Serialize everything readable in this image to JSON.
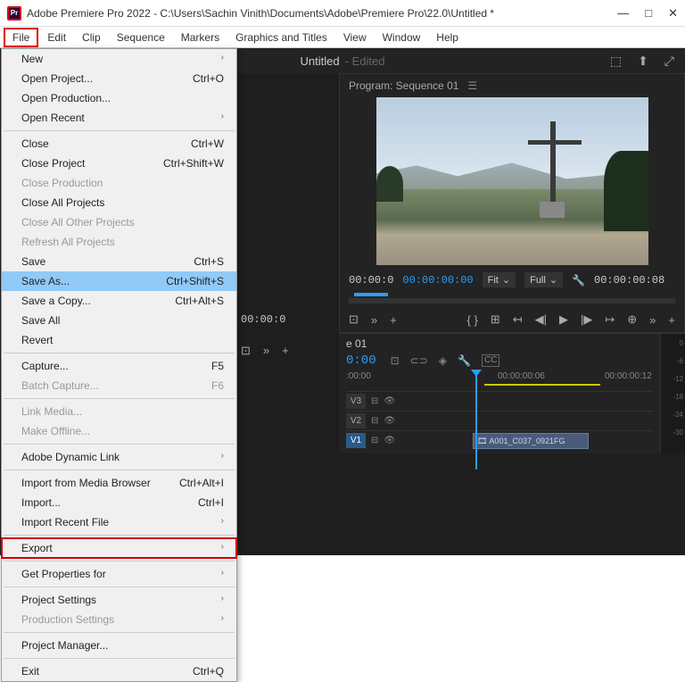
{
  "title": "Adobe Premiere Pro 2022 - C:\\Users\\Sachin Vinith\\Documents\\Adobe\\Premiere Pro\\22.0\\Untitled *",
  "app_icon_text": "Pr",
  "win": {
    "min": "—",
    "max": "□",
    "close": "✕"
  },
  "menubar": [
    "File",
    "Edit",
    "Clip",
    "Sequence",
    "Markers",
    "Graphics and Titles",
    "View",
    "Window",
    "Help"
  ],
  "top_tab": {
    "name": "Untitled",
    "state": "- Edited"
  },
  "icons_tr": [
    "⬚",
    "⬆",
    "⤢"
  ],
  "program": {
    "title": "Program: Sequence 01",
    "tc_left": "00:00:0",
    "tc_cur": "00:00:00:00",
    "fit": "Fit",
    "full": "Full",
    "tc_right": "00:00:00:08",
    "playbtns": [
      "{ }",
      "⊞",
      "↤",
      "◀|",
      "▶",
      "|▶",
      "↦",
      "⊕",
      "»",
      "+"
    ],
    "src_btns": [
      "⊡",
      "»",
      "+"
    ]
  },
  "seq": {
    "tab": "e 01",
    "time": "0:00",
    "ruler": [
      ":00:00",
      "00:00:00:06",
      "00:00:00:12",
      "00:00:00"
    ],
    "tracks": [
      {
        "lbl": "V3",
        "blue": false
      },
      {
        "lbl": "V2",
        "blue": false
      },
      {
        "lbl": "V1",
        "blue": true,
        "clip": "A001_C037_0921FG"
      }
    ],
    "meter": [
      "0",
      "-6",
      "-12",
      "-18",
      "-24",
      "-30"
    ]
  },
  "dropdown": [
    {
      "t": "item",
      "label": "New",
      "sub": true
    },
    {
      "t": "item",
      "label": "Open Project...",
      "sc": "Ctrl+O"
    },
    {
      "t": "item",
      "label": "Open Production..."
    },
    {
      "t": "item",
      "label": "Open Recent",
      "sub": true
    },
    {
      "t": "sep"
    },
    {
      "t": "item",
      "label": "Close",
      "sc": "Ctrl+W"
    },
    {
      "t": "item",
      "label": "Close Project",
      "sc": "Ctrl+Shift+W"
    },
    {
      "t": "item",
      "label": "Close Production",
      "disabled": true
    },
    {
      "t": "item",
      "label": "Close All Projects"
    },
    {
      "t": "item",
      "label": "Close All Other Projects",
      "disabled": true
    },
    {
      "t": "item",
      "label": "Refresh All Projects",
      "disabled": true
    },
    {
      "t": "item",
      "label": "Save",
      "sc": "Ctrl+S"
    },
    {
      "t": "item",
      "label": "Save As...",
      "sc": "Ctrl+Shift+S",
      "hl": true
    },
    {
      "t": "item",
      "label": "Save a Copy...",
      "sc": "Ctrl+Alt+S"
    },
    {
      "t": "item",
      "label": "Save All"
    },
    {
      "t": "item",
      "label": "Revert"
    },
    {
      "t": "sep"
    },
    {
      "t": "item",
      "label": "Capture...",
      "sc": "F5"
    },
    {
      "t": "item",
      "label": "Batch Capture...",
      "sc": "F6",
      "disabled": true
    },
    {
      "t": "sep"
    },
    {
      "t": "item",
      "label": "Link Media...",
      "disabled": true
    },
    {
      "t": "item",
      "label": "Make Offline...",
      "disabled": true
    },
    {
      "t": "sep"
    },
    {
      "t": "item",
      "label": "Adobe Dynamic Link",
      "sub": true
    },
    {
      "t": "sep"
    },
    {
      "t": "item",
      "label": "Import from Media Browser",
      "sc": "Ctrl+Alt+I"
    },
    {
      "t": "item",
      "label": "Import...",
      "sc": "Ctrl+I"
    },
    {
      "t": "item",
      "label": "Import Recent File",
      "sub": true
    },
    {
      "t": "sep"
    },
    {
      "t": "item",
      "label": "Export",
      "sub": true,
      "boxed": true
    },
    {
      "t": "sep"
    },
    {
      "t": "item",
      "label": "Get Properties for",
      "sub": true
    },
    {
      "t": "sep"
    },
    {
      "t": "item",
      "label": "Project Settings",
      "sub": true
    },
    {
      "t": "item",
      "label": "Production Settings",
      "sub": true,
      "disabled": true
    },
    {
      "t": "sep"
    },
    {
      "t": "item",
      "label": "Project Manager..."
    },
    {
      "t": "sep"
    },
    {
      "t": "item",
      "label": "Exit",
      "sc": "Ctrl+Q"
    }
  ]
}
